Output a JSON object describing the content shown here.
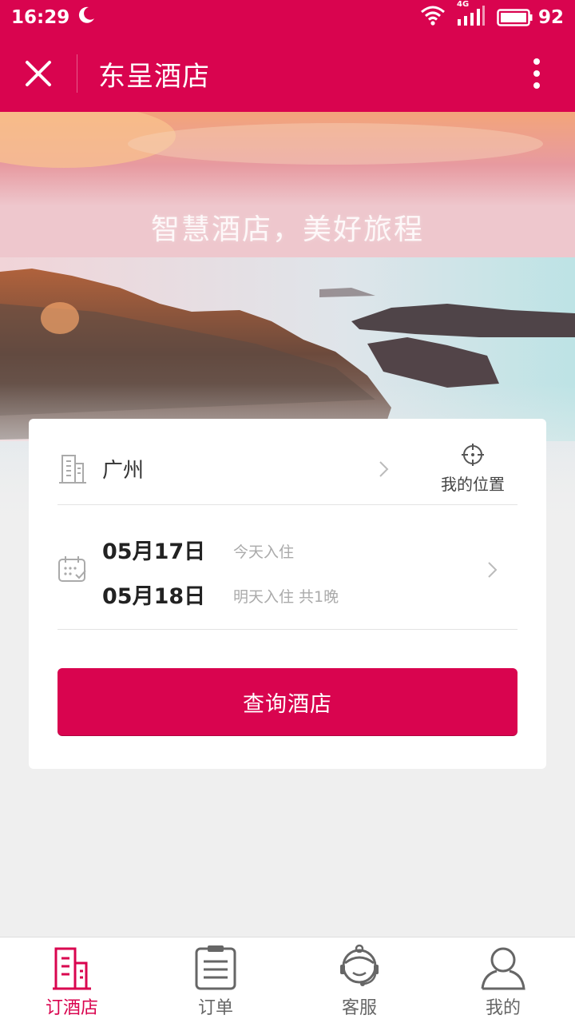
{
  "status_bar": {
    "time": "16:29",
    "network": "4G",
    "battery": "92",
    "icons": [
      "moon-icon",
      "wifi-icon",
      "signal-icon",
      "battery-icon"
    ]
  },
  "header": {
    "title": "东呈酒店",
    "icons": [
      "close-icon",
      "more-vertical-icon"
    ]
  },
  "hero": {
    "slogan": "智慧酒店，美好旅程"
  },
  "search": {
    "city": "广州",
    "locate_label": "我的位置",
    "checkin_date": "05月17日",
    "checkin_note": "今天入住",
    "checkout_date": "05月18日",
    "checkout_note": "明天入住 共1晚",
    "button_label": "查询酒店",
    "icons": [
      "building-icon",
      "chevron-right-icon",
      "crosshair-icon",
      "calendar-icon"
    ]
  },
  "tabs": [
    {
      "label": "订酒店",
      "icon": "hotel-icon",
      "active": true
    },
    {
      "label": "订单",
      "icon": "order-clipboard-icon",
      "active": false
    },
    {
      "label": "客服",
      "icon": "customer-service-icon",
      "active": false
    },
    {
      "label": "我的",
      "icon": "user-icon",
      "active": false
    }
  ],
  "colors": {
    "brand": "#d9044f",
    "background": "#efefef",
    "muted_text": "#aaaaaa"
  }
}
